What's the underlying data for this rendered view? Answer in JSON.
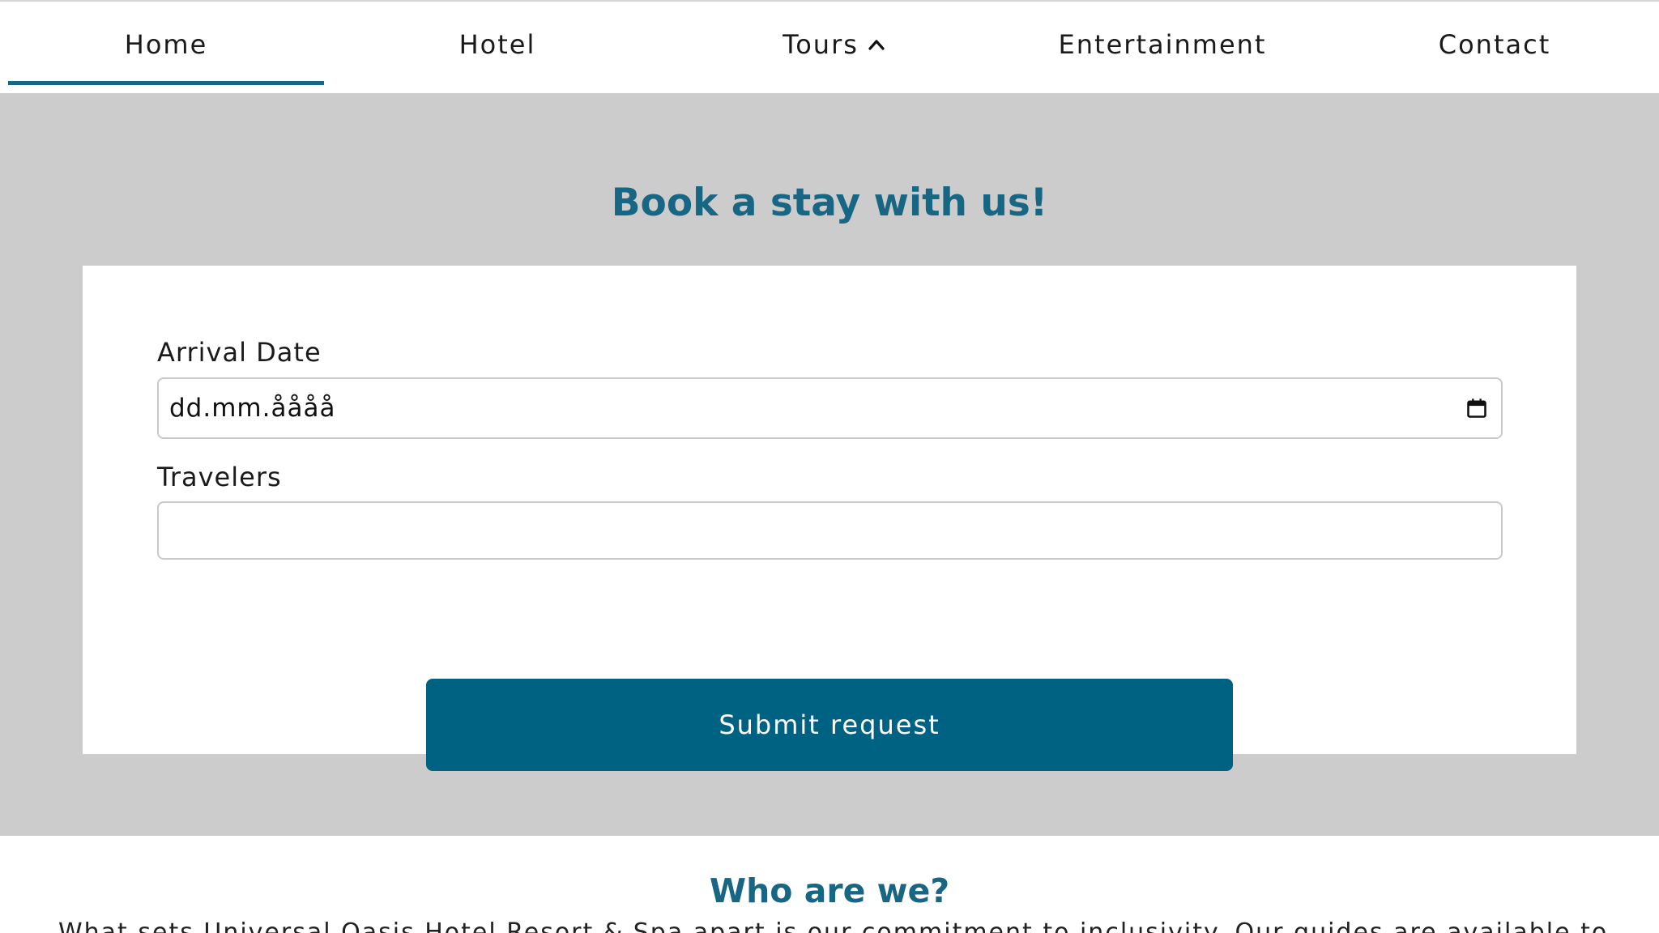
{
  "nav": {
    "items": [
      {
        "label": "Home",
        "active": true
      },
      {
        "label": "Hotel"
      },
      {
        "label": "Tours",
        "icon": "chevron-up-icon"
      },
      {
        "label": "Entertainment"
      },
      {
        "label": "Contact"
      }
    ]
  },
  "booking": {
    "title": "Book a stay with us!",
    "arrival_label": "Arrival Date",
    "arrival_value": "dd.mm.åååå",
    "travelers_label": "Travelers",
    "travelers_value": "",
    "submit_label": "Submit request"
  },
  "about": {
    "title": "Who are we?",
    "text": "What sets Universal Oasis Hotel Resort & Spa apart is our commitment to inclusivity. Our guides are available to"
  },
  "colors": {
    "accent": "#176683",
    "button": "#006283",
    "hero_bg": "#cccccc"
  }
}
